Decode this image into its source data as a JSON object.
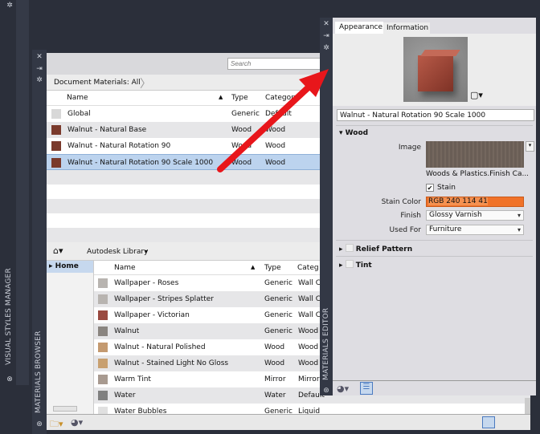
{
  "left_palette": {
    "label": "VISUAL STYLES MANAGER"
  },
  "browser": {
    "palette_label": "MATERIALS BROWSER",
    "search_placeholder": "Search",
    "doc_breadcrumb": "Document Materials: All",
    "doc_columns": [
      "Name",
      "Type",
      "Category"
    ],
    "doc_rows": [
      {
        "name": "Global",
        "type": "Generic",
        "category": "Default",
        "thumb": "#d8d8d8"
      },
      {
        "name": "Walnut - Natural Base",
        "type": "Wood",
        "category": "Wood",
        "thumb": "#7a3a2c"
      },
      {
        "name": "Walnut - Natural Rotation 90",
        "type": "Wood",
        "category": "Wood",
        "thumb": "#7a3a2c"
      },
      {
        "name": "Walnut - Natural Rotation 90 Scale 1000",
        "type": "Wood",
        "category": "Wood",
        "thumb": "#7a3a2c",
        "selected": true
      }
    ],
    "lib_breadcrumb": "Autodesk Library",
    "tree": [
      {
        "label": "Home"
      }
    ],
    "lib_columns": [
      "Name",
      "Type",
      "Category"
    ],
    "lib_rows": [
      {
        "name": "Wallpaper - Roses",
        "type": "Generic",
        "category": "Wall Covering",
        "thumb": "#b8b4b0"
      },
      {
        "name": "Wallpaper - Stripes Splatter",
        "type": "Generic",
        "category": "Wall Covering",
        "thumb": "#b8b4b0"
      },
      {
        "name": "Wallpaper - Victorian",
        "type": "Generic",
        "category": "Wall Covering",
        "thumb": "#9a4a40"
      },
      {
        "name": "Walnut",
        "type": "Generic",
        "category": "Wood",
        "thumb": "#8a8580"
      },
      {
        "name": "Walnut - Natural Polished",
        "type": "Wood",
        "category": "Wood",
        "thumb": "#c49a70"
      },
      {
        "name": "Walnut - Stained Light No Gloss",
        "type": "Wood",
        "category": "Wood",
        "thumb": "#c8a070"
      },
      {
        "name": "Warm Tint",
        "type": "Mirror",
        "category": "Mirror",
        "thumb": "#a89a90"
      },
      {
        "name": "Water",
        "type": "Water",
        "category": "Default",
        "thumb": "#808080"
      },
      {
        "name": "Water Bubbles",
        "type": "Generic",
        "category": "Liquid",
        "thumb": "#e0e0e0"
      }
    ]
  },
  "editor": {
    "palette_label": "MATERIALS EDITOR",
    "tabs": [
      "Appearance",
      "Information"
    ],
    "active_tab": "Appearance",
    "material_name": "Walnut - Natural Rotation 90 Scale 1000",
    "wood_section": "Wood",
    "image_label": "Image",
    "image_caption": "Woods & Plastics.Finish Ca...",
    "stain_label": "Stain",
    "stain_checked": true,
    "stain_color_label": "Stain Color",
    "stain_color_value": "RGB 240 114 41",
    "stain_color": "#f07229",
    "finish_label": "Finish",
    "finish_value": "Glossy Varnish",
    "used_for_label": "Used For",
    "used_for_value": "Furniture",
    "relief_section": "Relief Pattern",
    "tint_section": "Tint"
  },
  "annotation": {
    "arrow_color": "#e8161b"
  }
}
